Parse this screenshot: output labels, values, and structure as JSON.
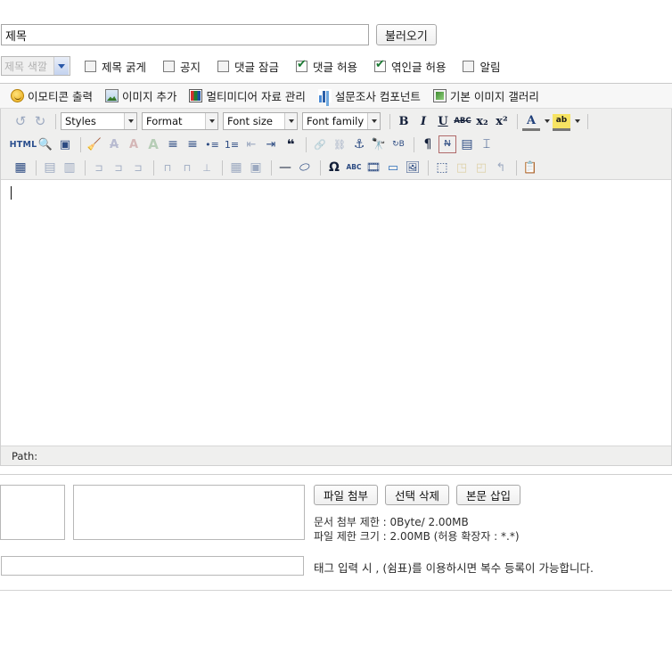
{
  "title_row": {
    "title_value": "제목",
    "title_placeholder": "제목",
    "load_button": "불러오기"
  },
  "options_row": {
    "color_select": {
      "selected": "제목 색깔",
      "disabled": true
    },
    "checkboxes": [
      {
        "label": "제목 굵게",
        "checked": false
      },
      {
        "label": "공지",
        "checked": false
      },
      {
        "label": "댓글 잠금",
        "checked": false
      },
      {
        "label": "댓글 허용",
        "checked": true
      },
      {
        "label": "엮인글 허용",
        "checked": true
      },
      {
        "label": "알림",
        "checked": false
      }
    ]
  },
  "plugin_bar": {
    "items": [
      {
        "label": "이모티콘 출력",
        "icon": "smiley-icon"
      },
      {
        "label": "이미지 추가",
        "icon": "image-icon"
      },
      {
        "label": "멀티미디어 자료 관리",
        "icon": "media-icon"
      },
      {
        "label": "설문조사 컴포넌트",
        "icon": "poll-chart-icon"
      },
      {
        "label": "기본 이미지 갤러리",
        "icon": "gallery-icon"
      }
    ]
  },
  "editor": {
    "toolbar_row1": {
      "undo": {
        "name": "undo-icon",
        "glyph": "↺",
        "disabled": true
      },
      "redo": {
        "name": "redo-icon",
        "glyph": "↻",
        "disabled": true
      },
      "selects": [
        {
          "name": "styles-select",
          "label": "Styles"
        },
        {
          "name": "format-select",
          "label": "Format"
        },
        {
          "name": "font-size-select",
          "label": "Font size"
        },
        {
          "name": "font-family-select",
          "label": "Font family"
        }
      ],
      "buttons": [
        {
          "name": "bold-icon",
          "glyph": "B"
        },
        {
          "name": "italic-icon",
          "glyph": "I"
        },
        {
          "name": "underline-icon",
          "glyph": "U"
        },
        {
          "name": "strikethrough-icon",
          "glyph": "ABC"
        },
        {
          "name": "subscript-icon",
          "glyph": "x₂"
        },
        {
          "name": "superscript-icon",
          "glyph": "x²"
        },
        {
          "name": "text-color-icon",
          "glyph": "A"
        },
        {
          "name": "background-color-icon",
          "glyph": "ab"
        }
      ]
    },
    "toolbar_row2": [
      {
        "name": "html-source-icon",
        "glyph": "HTML"
      },
      {
        "name": "preview-icon",
        "glyph": "🔍"
      },
      {
        "name": "fullscreen-icon",
        "glyph": "▣"
      },
      {
        "name": "cleanup-icon",
        "glyph": "🧹"
      },
      {
        "name": "remove-format-icon",
        "glyph": "A"
      },
      {
        "name": "decrease-font-icon",
        "glyph": "A"
      },
      {
        "name": "increase-font-icon",
        "glyph": "A"
      },
      {
        "name": "align-left-icon",
        "glyph": "≡"
      },
      {
        "name": "align-right-icon",
        "glyph": "≡"
      },
      {
        "name": "bullet-list-icon",
        "glyph": "•≡"
      },
      {
        "name": "numbered-list-icon",
        "glyph": "1≡"
      },
      {
        "name": "outdent-icon",
        "glyph": "⇤"
      },
      {
        "name": "indent-icon",
        "glyph": "⇥"
      },
      {
        "name": "blockquote-icon",
        "glyph": "❝"
      },
      {
        "name": "link-icon",
        "glyph": "🔗"
      },
      {
        "name": "unlink-icon",
        "glyph": "⛓"
      },
      {
        "name": "anchor-icon",
        "glyph": "⚓"
      },
      {
        "name": "find-icon",
        "glyph": "🔭"
      },
      {
        "name": "replace-icon",
        "glyph": "↻B"
      },
      {
        "name": "paragraph-mark-icon",
        "glyph": "¶"
      },
      {
        "name": "text-direction-icon",
        "glyph": "N"
      },
      {
        "name": "page-layout-icon",
        "glyph": "▤"
      },
      {
        "name": "page-break-icon",
        "glyph": "⌶"
      }
    ],
    "toolbar_row3": [
      {
        "name": "table-editor-icon",
        "glyph": "▦"
      },
      {
        "name": "table-merge-cells-icon",
        "glyph": "▤"
      },
      {
        "name": "table-split-cells-icon",
        "glyph": "▥"
      },
      {
        "name": "insert-row-before-icon",
        "glyph": "⊐"
      },
      {
        "name": "insert-row-after-icon",
        "glyph": "⊐"
      },
      {
        "name": "delete-row-icon",
        "glyph": "⊐"
      },
      {
        "name": "insert-column-before-icon",
        "glyph": "⊓"
      },
      {
        "name": "insert-column-after-icon",
        "glyph": "⊓"
      },
      {
        "name": "delete-column-icon",
        "glyph": "⊥"
      },
      {
        "name": "table-properties-icon",
        "glyph": "▦"
      },
      {
        "name": "cell-properties-icon",
        "glyph": "▣"
      },
      {
        "name": "horizontal-rule-icon",
        "glyph": "—"
      },
      {
        "name": "eraser-icon",
        "glyph": "⬭"
      },
      {
        "name": "special-character-icon",
        "glyph": "Ω"
      },
      {
        "name": "spellcheck-icon",
        "glyph": "ABC"
      },
      {
        "name": "media-film-icon",
        "glyph": "🎞"
      },
      {
        "name": "insert-button-icon",
        "glyph": "▭"
      },
      {
        "name": "insert-image-icon",
        "glyph": "🖼"
      },
      {
        "name": "select-area-icon",
        "glyph": "⬚"
      },
      {
        "name": "layer-forward-icon",
        "glyph": "◳"
      },
      {
        "name": "layer-backward-icon",
        "glyph": "◰"
      },
      {
        "name": "move-layer-icon",
        "glyph": "↰"
      },
      {
        "name": "template-icon",
        "glyph": "📋"
      }
    ],
    "body_content": "",
    "path_label": "Path:"
  },
  "attachments": {
    "buttons": [
      {
        "name": "attach-file-button",
        "label": "파일 첨부"
      },
      {
        "name": "delete-selected-button",
        "label": "선택 삭제"
      },
      {
        "name": "insert-into-body-button",
        "label": "본문 삽입"
      }
    ],
    "info_line1": "문서 첨부 제한 : 0Byte/ 2.00MB",
    "info_line2": "파일 제한 크기 : 2.00MB (허용 확장자 : *.*)"
  },
  "tags": {
    "input_value": "",
    "help_text": "태그 입력 시 , (쉼표)를 이용하시면 복수 등록이 가능합니다."
  },
  "colors": {
    "toolbar_bg": "#efefee",
    "plugin_bar_bg": "#f7f7f7",
    "check_green": "#1a7a32",
    "icon_blue": "#2c4b82"
  }
}
